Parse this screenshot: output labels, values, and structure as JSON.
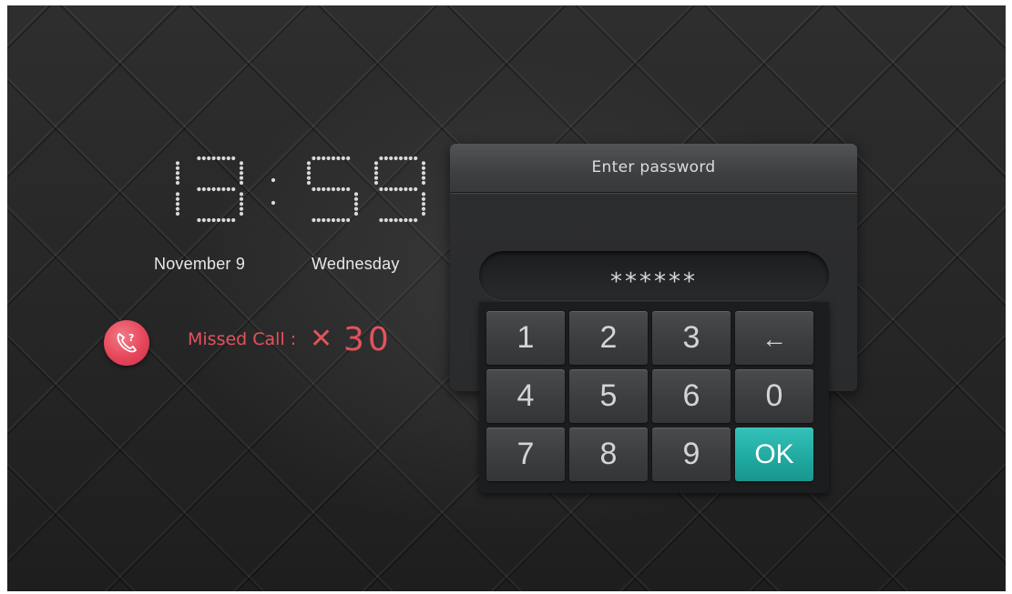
{
  "clock": {
    "time": "13:59",
    "hours": "13",
    "minutes": "59",
    "dot_color": "#d9d9d9"
  },
  "date": {
    "day": "November 9",
    "weekday": "Wednesday"
  },
  "missed_call": {
    "icon": "missed-call-phone-icon",
    "label": "Missed Call :",
    "multiplier": "✕",
    "count": "30",
    "color": "#e4525d"
  },
  "dialog": {
    "title": "Enter password",
    "password_value": "******"
  },
  "keypad": {
    "keys": [
      {
        "id": "key-1",
        "label": "1"
      },
      {
        "id": "key-2",
        "label": "2"
      },
      {
        "id": "key-3",
        "label": "3"
      },
      {
        "id": "key-backspace",
        "label": "←",
        "icon": "backspace-arrow-icon"
      },
      {
        "id": "key-4",
        "label": "4"
      },
      {
        "id": "key-5",
        "label": "5"
      },
      {
        "id": "key-6",
        "label": "6"
      },
      {
        "id": "key-0",
        "label": "0"
      },
      {
        "id": "key-7",
        "label": "7"
      },
      {
        "id": "key-8",
        "label": "8"
      },
      {
        "id": "key-9",
        "label": "9"
      },
      {
        "id": "key-ok",
        "label": "OK"
      }
    ],
    "ok_color": "#1fa89f"
  }
}
